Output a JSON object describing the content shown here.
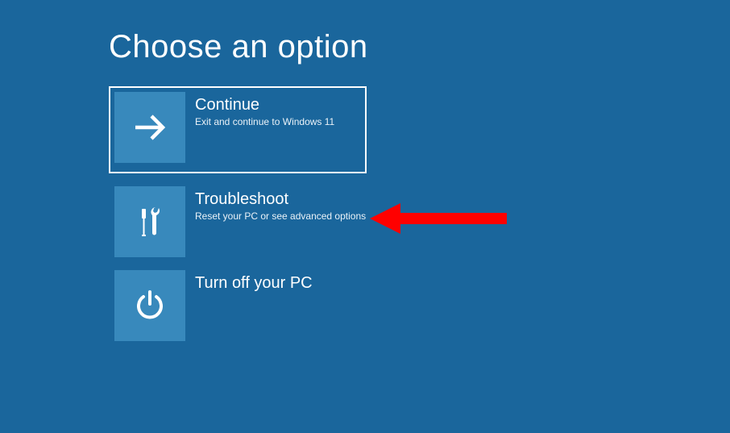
{
  "header": {
    "title": "Choose an option"
  },
  "tiles": {
    "continue": {
      "label": "Continue",
      "desc": "Exit and continue to Windows 11"
    },
    "troubleshoot": {
      "label": "Troubleshoot",
      "desc": "Reset your PC or see advanced options"
    },
    "turnoff": {
      "label": "Turn off your PC",
      "desc": ""
    }
  },
  "colors": {
    "background": "#1A669C",
    "tile": "#3889BC",
    "annotation": "#FF0000"
  }
}
